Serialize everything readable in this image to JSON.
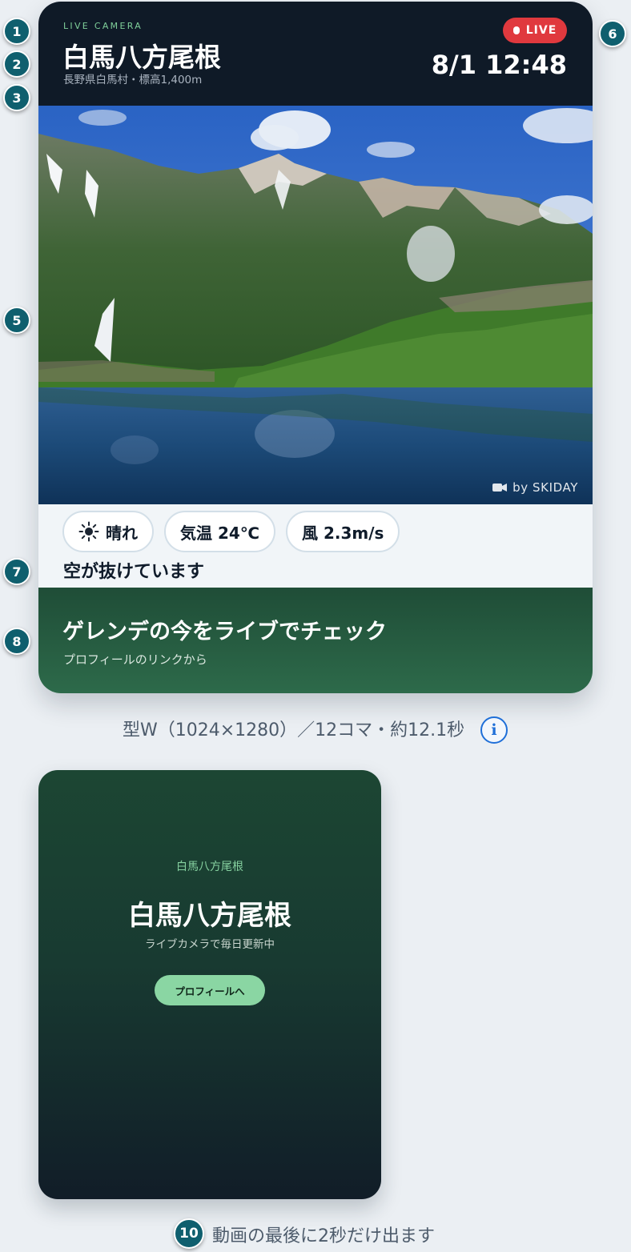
{
  "card": {
    "kicker": "LIVE CAMERA",
    "title": "白馬八方尾根",
    "subtitle": "長野県白馬村・標高1,400m",
    "live_label": "LIVE",
    "datetime": "8/1 12:48",
    "credit": "by SKIDAY",
    "chips": [
      {
        "icon": "sun-icon",
        "label": "晴れ"
      },
      {
        "label": "気温 24℃"
      },
      {
        "label": "風 2.3m/s"
      }
    ],
    "comment": "空が抜けています",
    "cta_title": "ゲレンデの今をライブでチェック",
    "cta_sub": "プロフィールのリンクから"
  },
  "caption1": "型W（1024×1280）／12コマ・約12.1秒",
  "end_card": {
    "kicker": "白馬八方尾根",
    "title": "白馬八方尾根",
    "sub": "ライブカメラで毎日更新中",
    "button": "プロフィールへ"
  },
  "caption2": "動画の最後に2秒だけ出ます",
  "badges": {
    "b1": "1",
    "b2": "2",
    "b3": "3",
    "b5": "5",
    "b6": "6",
    "b7": "7",
    "b8": "8",
    "b10": "10"
  },
  "colors": {
    "header_bg": "#0f1a27",
    "kicker": "#7fcf9a",
    "live_red": "#e0393e",
    "cta_green": "#2d6a4a",
    "badge": "#0f5f6e",
    "info_blue": "#1f6fd8"
  }
}
